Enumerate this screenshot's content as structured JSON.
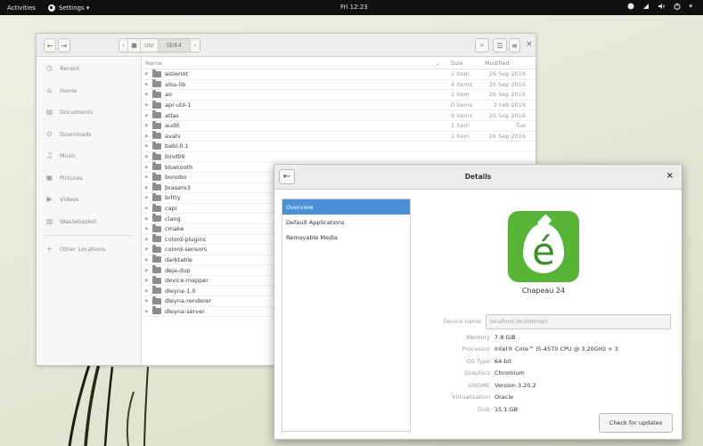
{
  "topbar": {
    "activities": "Activities",
    "app_menu": "Settings ▾",
    "clock": "Fri 12:23",
    "tray_icons": [
      "face-icon",
      "network-icon",
      "volume-icon",
      "power-icon"
    ],
    "tray_menu": "▾"
  },
  "files": {
    "nav_back": "←",
    "nav_forward": "→",
    "path_left": "‹",
    "path_items": [
      "■",
      "usr",
      "lib64"
    ],
    "path_right": "›",
    "search_icon": "⌕",
    "view_icon": "☰",
    "menu_icon": "≡",
    "close": "×",
    "sidebar": [
      {
        "label": "Recent",
        "icon": "clock-icon"
      },
      {
        "label": "Home",
        "icon": "home-icon"
      },
      {
        "label": "Documents",
        "icon": "document-icon"
      },
      {
        "label": "Downloads",
        "icon": "download-icon"
      },
      {
        "label": "Music",
        "icon": "music-icon"
      },
      {
        "label": "Pictures",
        "icon": "picture-icon"
      },
      {
        "label": "Videos",
        "icon": "video-icon"
      },
      {
        "label": "Wastebasket",
        "icon": "trash-icon"
      },
      {
        "label": "Other Locations",
        "icon": "plus-icon"
      }
    ],
    "columns": {
      "name": "Name",
      "size": "Size",
      "modified": "Modified",
      "sort_indicator": "⌄"
    },
    "rows": [
      {
        "name": "aisleriot",
        "size": "1 item",
        "modified": "26 Sep 2016"
      },
      {
        "name": "alsa-lib",
        "size": "4 items",
        "modified": "26 Sep 2016"
      },
      {
        "name": "ao",
        "size": "1 item",
        "modified": "26 Sep 2016"
      },
      {
        "name": "apr-util-1",
        "size": "0 items",
        "modified": "3 Feb 2016"
      },
      {
        "name": "atlas",
        "size": "4 items",
        "modified": "26 Sep 2016"
      },
      {
        "name": "audit",
        "size": "1 item",
        "modified": "Tue"
      },
      {
        "name": "avahi",
        "size": "1 item",
        "modified": "26 Sep 2016"
      },
      {
        "name": "babl-0.1",
        "size": "",
        "modified": ""
      },
      {
        "name": "bind99",
        "size": "",
        "modified": ""
      },
      {
        "name": "bluetooth",
        "size": "",
        "modified": ""
      },
      {
        "name": "bonobo",
        "size": "",
        "modified": ""
      },
      {
        "name": "brasero3",
        "size": "",
        "modified": ""
      },
      {
        "name": "brltty",
        "size": "",
        "modified": ""
      },
      {
        "name": "capi",
        "size": "",
        "modified": ""
      },
      {
        "name": "clang",
        "size": "",
        "modified": ""
      },
      {
        "name": "cmake",
        "size": "",
        "modified": ""
      },
      {
        "name": "colord-plugins",
        "size": "",
        "modified": ""
      },
      {
        "name": "colord-sensors",
        "size": "",
        "modified": ""
      },
      {
        "name": "darktable",
        "size": "",
        "modified": ""
      },
      {
        "name": "deja-dup",
        "size": "",
        "modified": ""
      },
      {
        "name": "device-mapper",
        "size": "",
        "modified": ""
      },
      {
        "name": "dleyna-1.0",
        "size": "",
        "modified": ""
      },
      {
        "name": "dleyna-renderer",
        "size": "",
        "modified": ""
      },
      {
        "name": "dleyna-server",
        "size": "",
        "modified": ""
      }
    ]
  },
  "details": {
    "back": "←",
    "title": "Details",
    "close": "×",
    "nav": [
      {
        "label": "Overview",
        "selected": true
      },
      {
        "label": "Default Applications",
        "selected": false
      },
      {
        "label": "Removable Media",
        "selected": false
      }
    ],
    "logo_letter": "é",
    "system_name": "Chapeau 24",
    "device_name_label": "Device name",
    "device_name_value": "localhost.localdomain",
    "specs": [
      {
        "key": "Memory",
        "value": "7.8 GiB"
      },
      {
        "key": "Processor",
        "value": "Intel® Core™ i5-4570 CPU @ 3.20GHz × 3"
      },
      {
        "key": "OS Type",
        "value": "64-bit"
      },
      {
        "key": "Graphics",
        "value": "Chromium"
      },
      {
        "key": "GNOME",
        "value": "Version 3.20.2"
      },
      {
        "key": "Virtualisation",
        "value": "Oracle"
      },
      {
        "key": "Disk",
        "value": "15.1 GB"
      }
    ],
    "check_updates": "Check for updates",
    "logo_color": "#57b436",
    "selection_color": "#4a90d9"
  }
}
